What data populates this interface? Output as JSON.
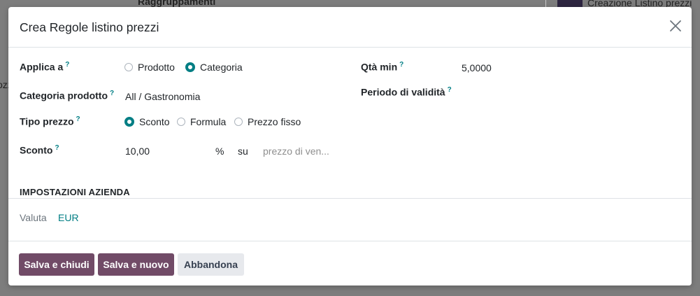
{
  "background": {
    "heading_partial": "Raggruppamenti",
    "right_text_partial": "Creazione Listino prezzi ef",
    "left_text_partial": "ozz"
  },
  "modal": {
    "title": "Crea Regole listino prezzi",
    "close_icon": "close-icon"
  },
  "form": {
    "help_marker": "?",
    "apply_to": {
      "label": "Applica a",
      "options": [
        "Prodotto",
        "Categoria"
      ],
      "selected": "Categoria"
    },
    "product_category": {
      "label": "Categoria prodotto",
      "value": "All / Gastronomia"
    },
    "price_type": {
      "label": "Tipo prezzo",
      "options": [
        "Sconto",
        "Formula",
        "Prezzo fisso"
      ],
      "selected": "Sconto"
    },
    "discount": {
      "label": "Sconto",
      "value": "10,00",
      "unit": "%",
      "on_label": "su",
      "base_placeholder": "prezzo di ven..."
    },
    "min_qty": {
      "label": "Qtà min",
      "value": "5,0000"
    },
    "validity": {
      "label": "Periodo di validità"
    }
  },
  "company_settings": {
    "section_title": "IMPOSTAZIONI AZIENDA",
    "currency_label": "Valuta",
    "currency_value": "EUR"
  },
  "footer": {
    "save_close": "Salva e chiudi",
    "save_new": "Salva e nuovo",
    "discard": "Abbandona"
  },
  "colors": {
    "primary": "#714b67",
    "accent": "#017e84",
    "secondary_button": "#e7e9ed"
  }
}
